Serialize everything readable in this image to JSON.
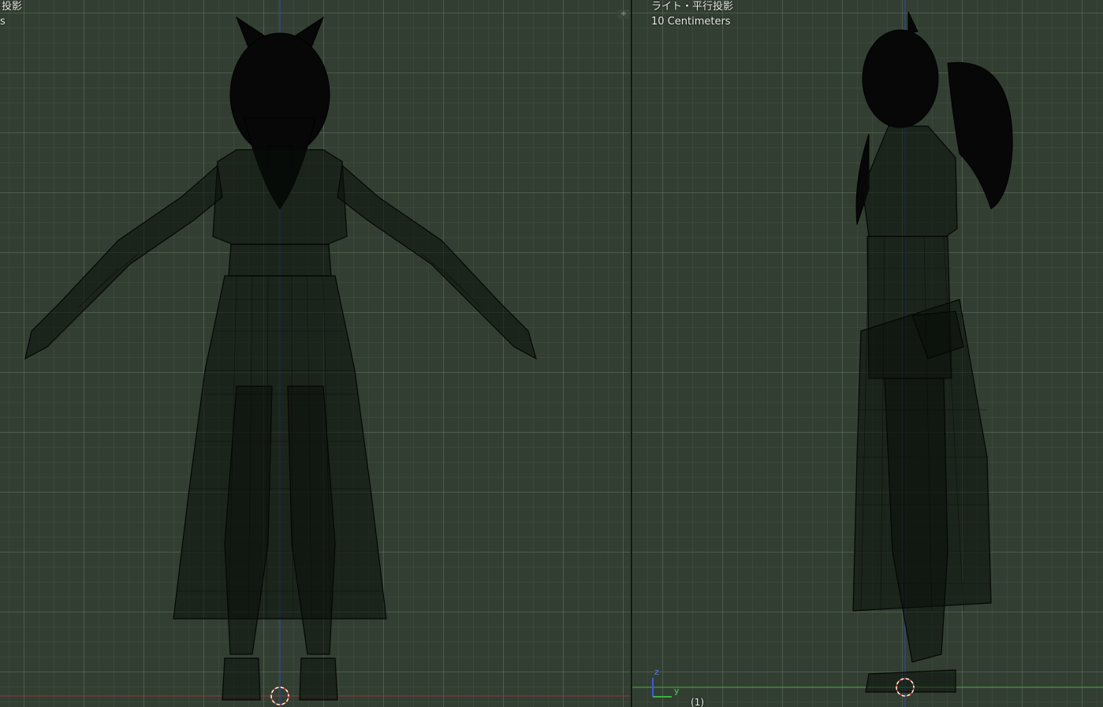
{
  "left_viewport": {
    "view_label_line1": "投影",
    "view_label_line2": "s"
  },
  "right_viewport": {
    "view_label": "ライト・平行投影",
    "grid_scale": "10 Centimeters",
    "frame_indicator": "(1)",
    "axis_z": "z",
    "axis_y": "y"
  },
  "split_handles": [
    "+",
    "+"
  ],
  "colors": {
    "background": "#323e31",
    "grid_major": "#6e8269",
    "axis_z_line": "#2b4bbf",
    "axis_x_line": "#8a3b3b",
    "axis_y_line": "#3fae3f",
    "cursor_red": "#d63c2a",
    "wireframe": "#050605"
  },
  "icons": [
    "3d-cursor-icon",
    "axis-gizmo-icon",
    "split-handle-icon"
  ]
}
